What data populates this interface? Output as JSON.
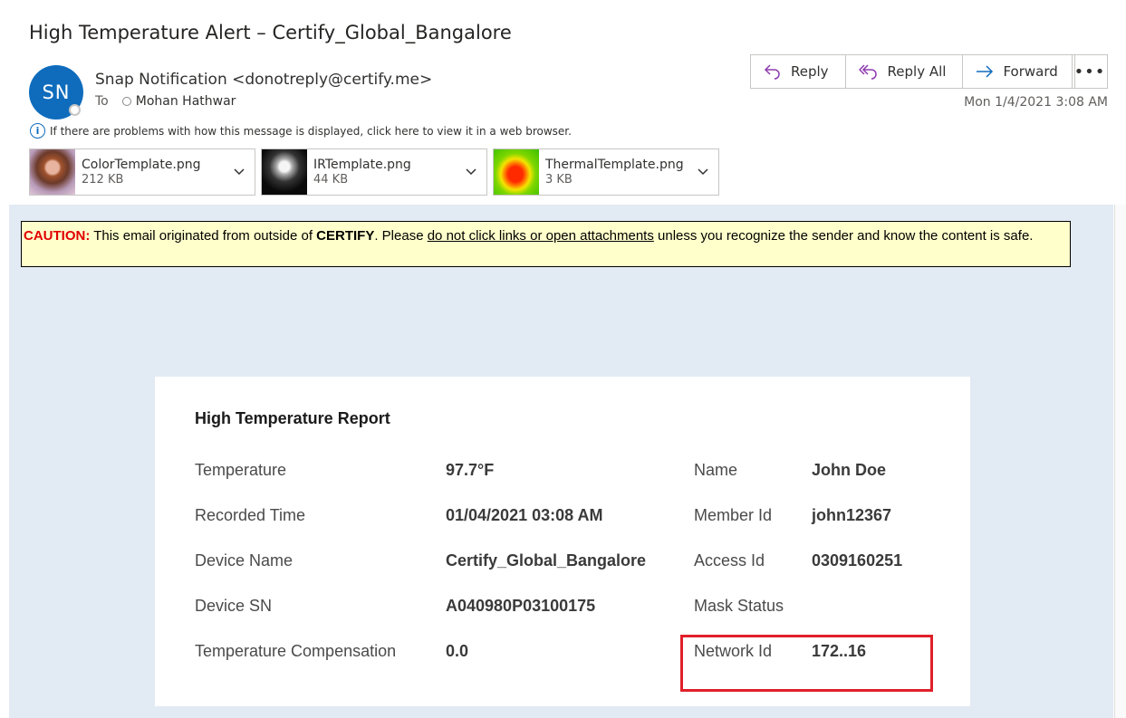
{
  "email": {
    "subject": "High Temperature Alert – Certify_Global_Bangalore",
    "sender": {
      "initials": "SN",
      "display": "Snap Notification <donotreply@certify.me>"
    },
    "to_label": "To",
    "to_name": "Mohan Hathwar",
    "date": "Mon 1/4/2021 3:08 AM",
    "info_text": "If there are problems with how this message is displayed, click here to view it in a web browser."
  },
  "actions": {
    "reply": "Reply",
    "reply_all": "Reply All",
    "forward": "Forward",
    "more": "•••"
  },
  "attachments": [
    {
      "name": "ColorTemplate.png",
      "size": "212 KB"
    },
    {
      "name": "IRTemplate.png",
      "size": "44 KB"
    },
    {
      "name": "ThermalTemplate.png",
      "size": "3 KB"
    }
  ],
  "caution": {
    "label": "CAUTION:",
    "part1": " This email originated from outside of ",
    "org": "CERTIFY",
    "part2": ". Please ",
    "link_text": "do not click links or open attachments",
    "part3": " unless you recognize the sender and know the content is safe."
  },
  "report": {
    "title": "High Temperature Report",
    "left": [
      {
        "label": "Temperature",
        "value": "97.7°F"
      },
      {
        "label": "Recorded Time",
        "value": "01/04/2021 03:08 AM"
      },
      {
        "label": "Device Name",
        "value": "Certify_Global_Bangalore"
      },
      {
        "label": "Device SN",
        "value": "A040980P03100175"
      },
      {
        "label": "Temperature Compensation",
        "value": "0.0"
      }
    ],
    "right": [
      {
        "label": "Name",
        "value": "John Doe"
      },
      {
        "label": "Member Id",
        "value": "john12367"
      },
      {
        "label": "Access Id",
        "value": "0309160251"
      },
      {
        "label": "Mask Status",
        "value": ""
      },
      {
        "label": "Network Id",
        "value": "172..16"
      }
    ]
  },
  "colors": {
    "avatar": "#0f6cbd",
    "caution_bg": "#ffffcc",
    "caution_label": "#e00000",
    "body_bg": "#e2eaf4",
    "highlight_box": "#e0202a"
  },
  "icons": [
    "reply-icon",
    "reply-all-icon",
    "forward-icon",
    "info-icon",
    "chevron-down-icon"
  ]
}
